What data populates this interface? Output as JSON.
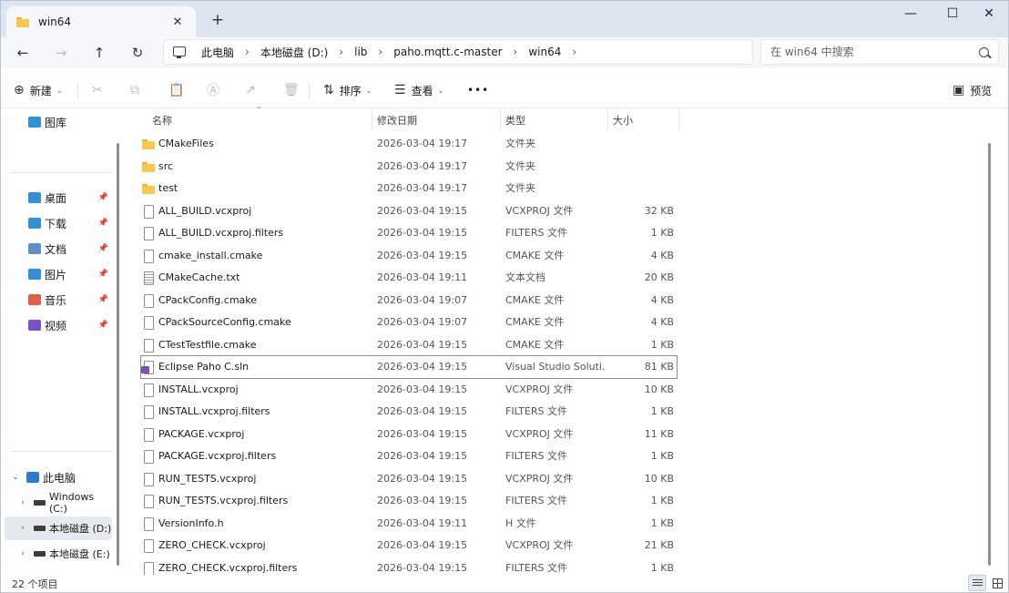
{
  "titlebar": {
    "tab_title": "win64",
    "tab_close": "✕",
    "new_tab": "+"
  },
  "window_controls": {
    "minimize": "—",
    "maximize": "☐",
    "close": "✕"
  },
  "address": {
    "breadcrumbs": [
      "此电脑",
      "本地磁盘 (D:)",
      "lib",
      "paho.mqtt.c-master",
      "win64"
    ],
    "separator": "›",
    "search_placeholder": "在 win64 中搜索"
  },
  "commandbar": {
    "new_label": "新建",
    "sort_label": "排序",
    "view_label": "查看",
    "more_label": "•••",
    "preview_label": "预览"
  },
  "sidebar": {
    "top": "图库",
    "quick": [
      {
        "label": "桌面",
        "color": "#2f8fd8"
      },
      {
        "label": "下载",
        "color": "#2f8fd8"
      },
      {
        "label": "文档",
        "color": "#5b8fd0"
      },
      {
        "label": "图片",
        "color": "#2f8fd8"
      },
      {
        "label": "音乐",
        "color": "#e85d4a"
      },
      {
        "label": "视频",
        "color": "#7a4fcf"
      }
    ],
    "this_pc": "此电脑",
    "drives": [
      "Windows (C:)",
      "本地磁盘 (D:)",
      "本地磁盘 (E:)"
    ]
  },
  "columns": {
    "name": "名称",
    "date": "修改日期",
    "type": "类型",
    "size": "大小"
  },
  "files": [
    {
      "name": "CMakeFiles",
      "date": "2026-03-04 19:17",
      "type": "文件夹",
      "size": "",
      "icon": "folder"
    },
    {
      "name": "src",
      "date": "2026-03-04 19:17",
      "type": "文件夹",
      "size": "",
      "icon": "folder"
    },
    {
      "name": "test",
      "date": "2026-03-04 19:17",
      "type": "文件夹",
      "size": "",
      "icon": "folder"
    },
    {
      "name": "ALL_BUILD.vcxproj",
      "date": "2026-03-04 19:15",
      "type": "VCXPROJ 文件",
      "size": "32 KB",
      "icon": "doc"
    },
    {
      "name": "ALL_BUILD.vcxproj.filters",
      "date": "2026-03-04 19:15",
      "type": "FILTERS 文件",
      "size": "1 KB",
      "icon": "doc"
    },
    {
      "name": "cmake_install.cmake",
      "date": "2026-03-04 19:15",
      "type": "CMAKE 文件",
      "size": "4 KB",
      "icon": "doc"
    },
    {
      "name": "CMakeCache.txt",
      "date": "2026-03-04 19:11",
      "type": "文本文档",
      "size": "20 KB",
      "icon": "txt"
    },
    {
      "name": "CPackConfig.cmake",
      "date": "2026-03-04 19:07",
      "type": "CMAKE 文件",
      "size": "4 KB",
      "icon": "doc"
    },
    {
      "name": "CPackSourceConfig.cmake",
      "date": "2026-03-04 19:07",
      "type": "CMAKE 文件",
      "size": "4 KB",
      "icon": "doc"
    },
    {
      "name": "CTestTestfile.cmake",
      "date": "2026-03-04 19:15",
      "type": "CMAKE 文件",
      "size": "1 KB",
      "icon": "doc"
    },
    {
      "name": "Eclipse Paho C.sln",
      "date": "2026-03-04 19:15",
      "type": "Visual Studio Soluti...",
      "size": "81 KB",
      "icon": "sln"
    },
    {
      "name": "INSTALL.vcxproj",
      "date": "2026-03-04 19:15",
      "type": "VCXPROJ 文件",
      "size": "10 KB",
      "icon": "doc"
    },
    {
      "name": "INSTALL.vcxproj.filters",
      "date": "2026-03-04 19:15",
      "type": "FILTERS 文件",
      "size": "1 KB",
      "icon": "doc"
    },
    {
      "name": "PACKAGE.vcxproj",
      "date": "2026-03-04 19:15",
      "type": "VCXPROJ 文件",
      "size": "11 KB",
      "icon": "doc"
    },
    {
      "name": "PACKAGE.vcxproj.filters",
      "date": "2026-03-04 19:15",
      "type": "FILTERS 文件",
      "size": "1 KB",
      "icon": "doc"
    },
    {
      "name": "RUN_TESTS.vcxproj",
      "date": "2026-03-04 19:15",
      "type": "VCXPROJ 文件",
      "size": "10 KB",
      "icon": "doc"
    },
    {
      "name": "RUN_TESTS.vcxproj.filters",
      "date": "2026-03-04 19:15",
      "type": "FILTERS 文件",
      "size": "1 KB",
      "icon": "doc"
    },
    {
      "name": "VersionInfo.h",
      "date": "2026-03-04 19:11",
      "type": "H 文件",
      "size": "1 KB",
      "icon": "doc"
    },
    {
      "name": "ZERO_CHECK.vcxproj",
      "date": "2026-03-04 19:15",
      "type": "VCXPROJ 文件",
      "size": "21 KB",
      "icon": "doc"
    },
    {
      "name": "ZERO_CHECK.vcxproj.filters",
      "date": "2026-03-04 19:15",
      "type": "FILTERS 文件",
      "size": "1 KB",
      "icon": "doc"
    }
  ],
  "focused_file": "Eclipse Paho C.sln",
  "status": {
    "item_count": "22 个项目"
  }
}
